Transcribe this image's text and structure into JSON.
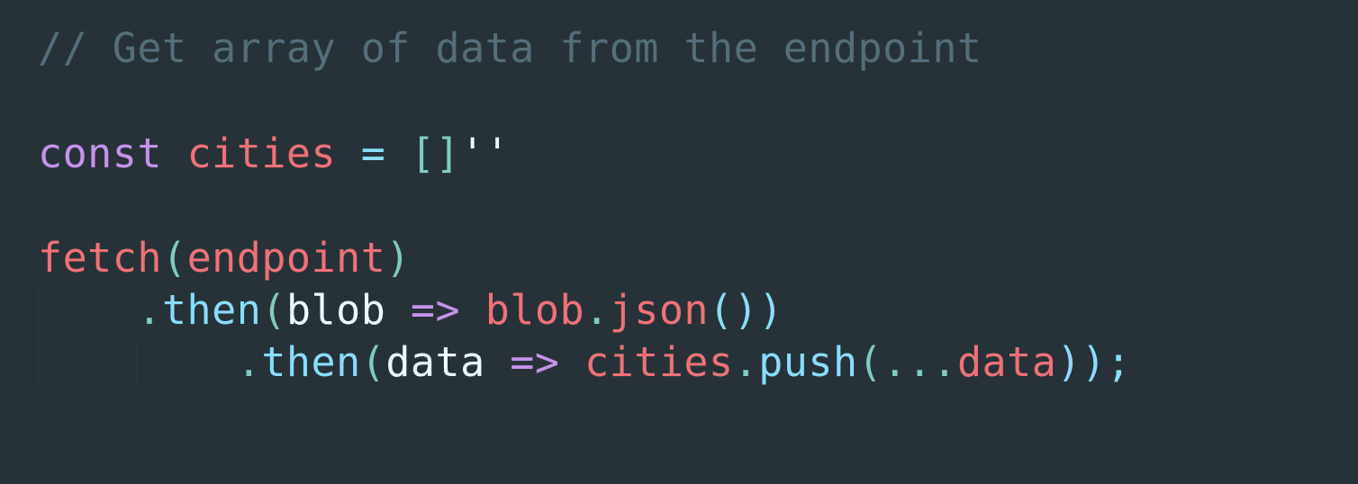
{
  "colors": {
    "background": "#263238",
    "comment": "#546e7a",
    "keyword": "#c792ea",
    "variable": "#f07178",
    "operator": "#89ddff",
    "punctuation": "#80cbc4",
    "plain": "#eeffff",
    "string": "#c3e88d",
    "method": "#82aaff",
    "indent_guide": "#2f3d44"
  },
  "code": {
    "lines": [
      {
        "tokens": [
          {
            "text": "// Get array of data from the endpoint",
            "type": "comment"
          }
        ]
      },
      {
        "tokens": []
      },
      {
        "tokens": [
          {
            "text": "const",
            "type": "keyword"
          },
          {
            "text": " ",
            "type": "plain"
          },
          {
            "text": "cities",
            "type": "variable"
          },
          {
            "text": " ",
            "type": "plain"
          },
          {
            "text": "=",
            "type": "operator"
          },
          {
            "text": " ",
            "type": "plain"
          },
          {
            "text": "[]",
            "type": "punctuation"
          },
          {
            "text": "''",
            "type": "plain"
          }
        ]
      },
      {
        "tokens": []
      },
      {
        "tokens": [
          {
            "text": "fetch",
            "type": "variable"
          },
          {
            "text": "(",
            "type": "punctuation"
          },
          {
            "text": "endpoint",
            "type": "variable"
          },
          {
            "text": ")",
            "type": "punctuation"
          }
        ]
      },
      {
        "tokens": [
          {
            "text": "    ",
            "type": "plain"
          },
          {
            "text": ".",
            "type": "punctuation"
          },
          {
            "text": "then",
            "type": "operator"
          },
          {
            "text": "(",
            "type": "punctuation"
          },
          {
            "text": "blob",
            "type": "plain"
          },
          {
            "text": " ",
            "type": "plain"
          },
          {
            "text": "=>",
            "type": "keyword"
          },
          {
            "text": " ",
            "type": "plain"
          },
          {
            "text": "blob",
            "type": "variable"
          },
          {
            "text": ".",
            "type": "punctuation"
          },
          {
            "text": "json",
            "type": "variable"
          },
          {
            "text": "())",
            "type": "operator"
          }
        ]
      },
      {
        "tokens": [
          {
            "text": "        ",
            "type": "plain"
          },
          {
            "text": ".",
            "type": "punctuation"
          },
          {
            "text": "then",
            "type": "operator"
          },
          {
            "text": "(",
            "type": "punctuation"
          },
          {
            "text": "data",
            "type": "plain"
          },
          {
            "text": " ",
            "type": "plain"
          },
          {
            "text": "=>",
            "type": "keyword"
          },
          {
            "text": " ",
            "type": "plain"
          },
          {
            "text": "cities",
            "type": "variable"
          },
          {
            "text": ".",
            "type": "punctuation"
          },
          {
            "text": "push",
            "type": "operator"
          },
          {
            "text": "(",
            "type": "punctuation"
          },
          {
            "text": "...",
            "type": "punctuation"
          },
          {
            "text": "data",
            "type": "variable"
          },
          {
            "text": "));",
            "type": "operator"
          }
        ]
      }
    ]
  }
}
